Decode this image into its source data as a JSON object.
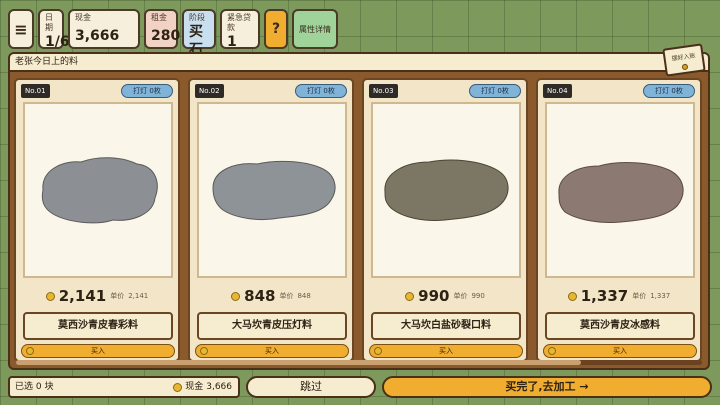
{
  "hud": {
    "menu_icon": "hamburger-menu-icon",
    "day": {
      "label": "日期",
      "value": "1/6"
    },
    "cash": {
      "label": "现金",
      "value": "3,666"
    },
    "rent": {
      "label": "租金",
      "value": "280"
    },
    "stage": {
      "label": "阶段",
      "value": "买石"
    },
    "loan": {
      "label": "紧急贷款",
      "value": "1"
    },
    "help": "?",
    "attributes": "属性详情"
  },
  "banner": {
    "title": "老张今日上的料",
    "rules_tab": "摆好入账"
  },
  "cards": [
    {
      "no": "No.01",
      "light": "打灯 0枚",
      "price": "2,141",
      "ref_label": "单价",
      "ref_price": "2,141",
      "name": "莫西沙青皮春彩料",
      "buy": "买入",
      "stone_color": "#8c9094"
    },
    {
      "no": "No.02",
      "light": "打灯 0枚",
      "price": "848",
      "ref_label": "单价",
      "ref_price": "848",
      "name": "大马坎青皮压灯料",
      "buy": "买入",
      "stone_color": "#8e9398"
    },
    {
      "no": "No.03",
      "light": "打灯 0枚",
      "price": "990",
      "ref_label": "单价",
      "ref_price": "990",
      "name": "大马坎白盐砂裂口料",
      "buy": "买入",
      "stone_color": "#7c7664"
    },
    {
      "no": "No.04",
      "light": "打灯 0枚",
      "price": "1,337",
      "ref_label": "单价",
      "ref_price": "1,337",
      "name": "莫西沙青皮冰感料",
      "buy": "买入",
      "stone_color": "#8c7a72"
    }
  ],
  "footer": {
    "status": "已选 0 块",
    "cash_label": "现金",
    "cash_value": "3,666",
    "skip": "跳过",
    "done": "买完了,去加工 →"
  },
  "colors": {
    "background": "#7d9a5c",
    "board": "#8a5a2c",
    "accent": "#f0ad30",
    "light_button": "#7fb3d8"
  }
}
